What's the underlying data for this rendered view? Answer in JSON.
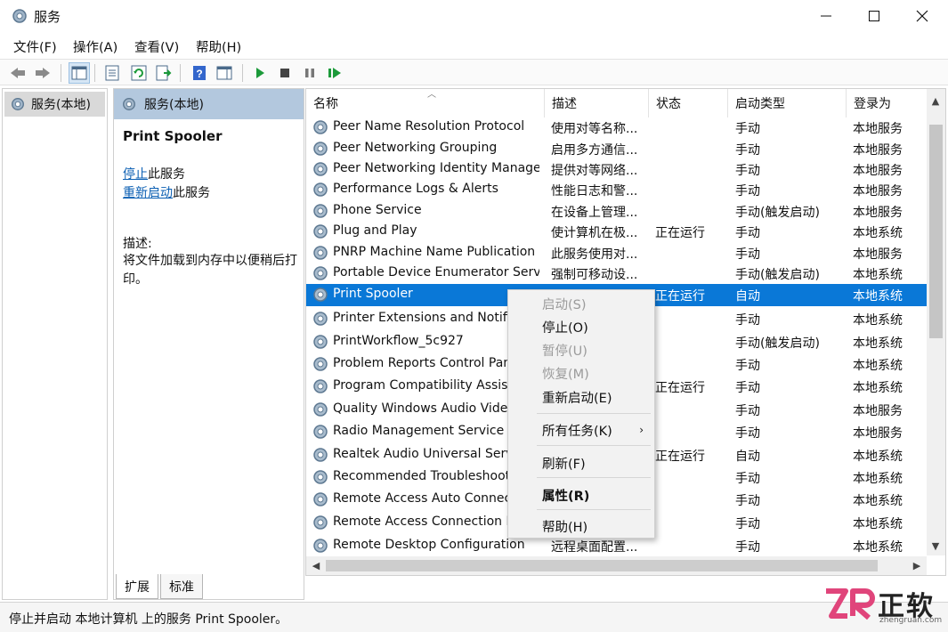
{
  "window": {
    "title": "服务"
  },
  "menu": [
    "文件(F)",
    "操作(A)",
    "查看(V)",
    "帮助(H)"
  ],
  "toolbar_icons": [
    "back-icon",
    "forward-icon",
    "console-tree-icon",
    "properties-icon",
    "refresh-icon",
    "export-icon",
    "help-icon",
    "show-hide-icon",
    "play-icon",
    "stop-icon",
    "pause-icon",
    "resume-icon"
  ],
  "tree": {
    "root_label": "服务(本地)"
  },
  "desc_panel": {
    "header": "服务(本地)",
    "service_name": "Print Spooler",
    "stop_link": "停止",
    "stop_suffix": "此服务",
    "restart_link": "重新启动",
    "restart_suffix": "此服务",
    "desc_label": "描述:",
    "desc_text": "将文件加载到内存中以便稍后打印。"
  },
  "bottom_tabs": [
    "扩展",
    "标准"
  ],
  "columns": [
    "名称",
    "描述",
    "状态",
    "启动类型",
    "登录为"
  ],
  "services": [
    {
      "name": "Peer Name Resolution Protocol",
      "desc": "使用对等名称...",
      "status": "",
      "startup": "手动",
      "logon": "本地服务"
    },
    {
      "name": "Peer Networking Grouping",
      "desc": "启用多方通信...",
      "status": "",
      "startup": "手动",
      "logon": "本地服务"
    },
    {
      "name": "Peer Networking Identity Manager",
      "desc": "提供对等网络...",
      "status": "",
      "startup": "手动",
      "logon": "本地服务"
    },
    {
      "name": "Performance Logs & Alerts",
      "desc": "性能日志和警...",
      "status": "",
      "startup": "手动",
      "logon": "本地服务"
    },
    {
      "name": "Phone Service",
      "desc": "在设备上管理...",
      "status": "",
      "startup": "手动(触发启动)",
      "logon": "本地服务"
    },
    {
      "name": "Plug and Play",
      "desc": "使计算机在极...",
      "status": "正在运行",
      "startup": "手动",
      "logon": "本地系统"
    },
    {
      "name": "PNRP Machine Name Publication Se",
      "desc": "此服务使用对...",
      "status": "",
      "startup": "手动",
      "logon": "本地服务"
    },
    {
      "name": "Portable Device Enumerator Service",
      "desc": "强制可移动设...",
      "status": "",
      "startup": "手动(触发启动)",
      "logon": "本地系统"
    },
    {
      "name": "Print Spooler",
      "desc": "",
      "status": "正在运行",
      "startup": "自动",
      "logon": "本地系统",
      "selected": true
    },
    {
      "name": "Printer Extensions and Notifica",
      "desc": "",
      "status": "",
      "startup": "手动",
      "logon": "本地系统"
    },
    {
      "name": "PrintWorkflow_5c927",
      "desc": "",
      "status": "",
      "startup": "手动(触发启动)",
      "logon": "本地系统"
    },
    {
      "name": "Problem Reports Control Pane",
      "desc": "",
      "status": "",
      "startup": "手动",
      "logon": "本地系统"
    },
    {
      "name": "Program Compatibility Assista",
      "desc": "",
      "status": "正在运行",
      "startup": "手动",
      "logon": "本地系统"
    },
    {
      "name": "Quality Windows Audio Video",
      "desc": "",
      "status": "",
      "startup": "手动",
      "logon": "本地服务"
    },
    {
      "name": "Radio Management Service",
      "desc": "",
      "status": "",
      "startup": "手动",
      "logon": "本地服务"
    },
    {
      "name": "Realtek Audio Universal Servie",
      "desc": "",
      "status": "正在运行",
      "startup": "自动",
      "logon": "本地系统"
    },
    {
      "name": "Recommended Troubleshootin",
      "desc": "",
      "status": "",
      "startup": "手动",
      "logon": "本地系统"
    },
    {
      "name": "Remote Access Auto Connectio",
      "desc": "",
      "status": "",
      "startup": "手动",
      "logon": "本地系统"
    },
    {
      "name": "Remote Access Connection Ma",
      "desc": "",
      "status": "",
      "startup": "手动",
      "logon": "本地系统"
    },
    {
      "name": "Remote Desktop Configuration",
      "desc": "远程桌面配置...",
      "status": "",
      "startup": "手动",
      "logon": "本地系统"
    }
  ],
  "context_menu": [
    {
      "label": "启动(S)",
      "disabled": true
    },
    {
      "label": "停止(O)"
    },
    {
      "label": "暂停(U)",
      "disabled": true
    },
    {
      "label": "恢复(M)",
      "disabled": true
    },
    {
      "label": "重新启动(E)"
    },
    {
      "sep": true
    },
    {
      "label": "所有任务(K)",
      "submenu": true
    },
    {
      "sep": true
    },
    {
      "label": "刷新(F)"
    },
    {
      "sep": true
    },
    {
      "label": "属性(R)",
      "bold": true
    },
    {
      "sep": true
    },
    {
      "label": "帮助(H)"
    }
  ],
  "status_bar": "停止并启动 本地计算机 上的服务 Print Spooler。",
  "watermark": {
    "main": "正软",
    "sub": "zhengruan.com"
  },
  "colors": {
    "selection": "#0a78d7",
    "header": "#b3c8de",
    "link": "#0b5fb3",
    "play": "#1c9a3a",
    "brand_pink": "#e0457b"
  }
}
